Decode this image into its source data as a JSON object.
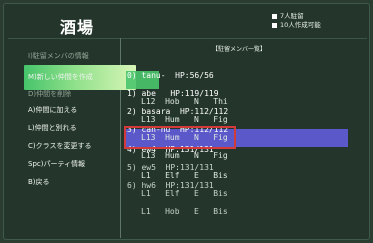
{
  "screen": {
    "title": "酒場"
  },
  "status": {
    "line1": "7人駐留",
    "line2": "10人作成可能"
  },
  "menu": {
    "items": [
      {
        "label": "I)駐留メンバの情報",
        "dim": true
      },
      {
        "label": "M)新しい仲間を作成",
        "dim": false
      },
      {
        "label": "D)仲間を削除",
        "dim": true
      },
      {
        "label": "A)仲間に加える",
        "dim": false
      },
      {
        "label": "L)仲間と別れる",
        "dim": false
      },
      {
        "label": "C)クラスを変更する",
        "dim": false
      },
      {
        "label": "Spc)パーティ情報",
        "dim": false
      },
      {
        "label": "B)戻る",
        "dim": false
      }
    ],
    "highlighted_index": 1
  },
  "roster": {
    "heading": "【駐留メンバ一覧】",
    "entries": [
      {
        "line1": "0) tanu-  HP:56/56",
        "line2": "L12  Hob   N   Thi"
      },
      {
        "line1": "1) abe   HP:119/119",
        "line2": "L13  Hum   N   Fig"
      },
      {
        "line1": "2) basara  HP:112/112",
        "line2": "L13  Hum   N   Fig"
      },
      {
        "line1": "3) can-nu  HP:112/112",
        "line2": "L13  Hum   N   Fig"
      },
      {
        "line1": "4) ew4  HP:131/131",
        "line2": "L1   Elf   E   Bis"
      },
      {
        "line1": "5) ew5  HP:131/131",
        "line2": "L1   Elf   E   Bis"
      },
      {
        "line1": "6) hw6  HP:131/131",
        "line2": "L1   Hob   E   Bis"
      }
    ],
    "selected_index": 4
  },
  "colors": {
    "background": "#24362b",
    "menu_highlight": "#46c46b",
    "selection_band": "#5b59c9",
    "selection_border": "#d43a3a"
  }
}
